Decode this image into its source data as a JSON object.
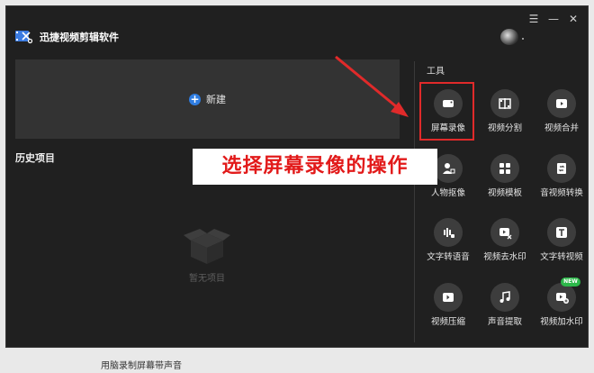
{
  "app": {
    "name": "迅捷视频剪辑软件"
  },
  "window_controls": {
    "menu": "☰",
    "minimize": "—",
    "close": "✕"
  },
  "new_project": {
    "label": "新建"
  },
  "history": {
    "title": "历史项目",
    "empty_text": "暂无项目"
  },
  "tools": {
    "title": "工具",
    "items": [
      {
        "label": "屏幕录像",
        "icon": "screen-record-icon"
      },
      {
        "label": "视频分割",
        "icon": "film-split-icon"
      },
      {
        "label": "视频合并",
        "icon": "video-merge-icon"
      },
      {
        "label": "人物抠像",
        "icon": "person-cutout-icon"
      },
      {
        "label": "视频模板",
        "icon": "template-icon"
      },
      {
        "label": "音视频转换",
        "icon": "convert-icon"
      },
      {
        "label": "文字转语音",
        "icon": "text-to-speech-icon"
      },
      {
        "label": "视频去水印",
        "icon": "remove-watermark-icon"
      },
      {
        "label": "文字转视频",
        "icon": "text-to-video-icon"
      },
      {
        "label": "视频压缩",
        "icon": "compress-icon"
      },
      {
        "label": "声音提取",
        "icon": "audio-extract-icon"
      },
      {
        "label": "视频加水印",
        "icon": "add-watermark-icon"
      }
    ],
    "new_badge": "NEW"
  },
  "annotation": {
    "text": "选择屏幕录像的操作",
    "color": "#e21a1a"
  },
  "colors": {
    "accent": "#2f7de1",
    "highlight": "#e02a2a",
    "badge": "#2db84a"
  },
  "bottom_text": "用脑录制屏幕带声音"
}
